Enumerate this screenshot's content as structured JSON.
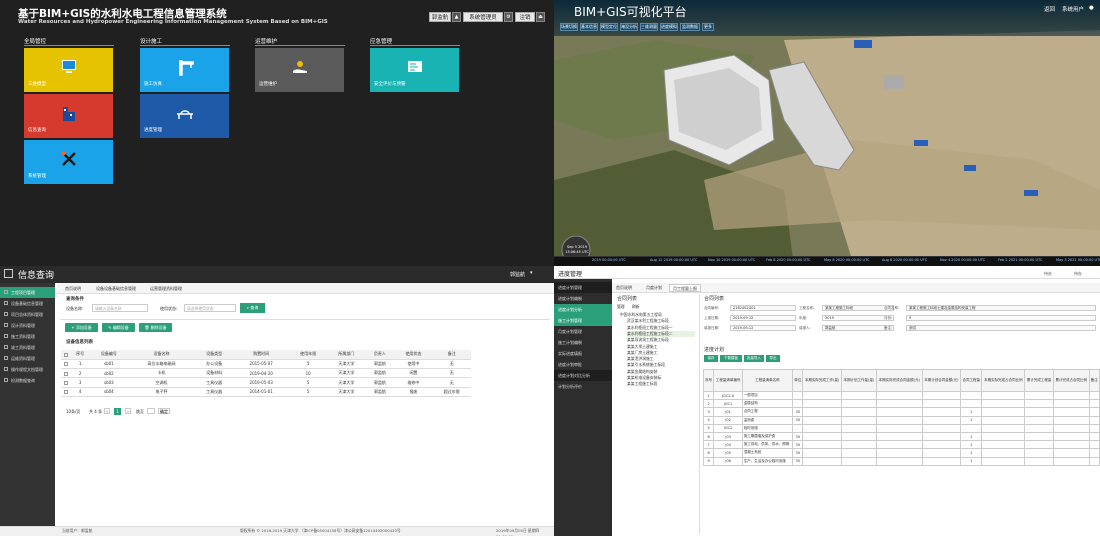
{
  "q1": {
    "title": "基于BIM+GIS的水利水电工程信息管理系统",
    "subtitle": "Water Resources and Hydropower Engineering Information Management System Based on BIM+GIS",
    "top_buttons": [
      "郭监航",
      "系统管理员",
      "注销"
    ],
    "categories": [
      "全局管控",
      "设计施工",
      "运营维护",
      "应急管理"
    ],
    "tiles": [
      {
        "label": "三维模型",
        "color": "#e6c300",
        "icon": "monitor-icon"
      },
      {
        "label": "施工仿真",
        "color": "#1aa3e8",
        "icon": "crane-icon"
      },
      {
        "label": "运营维护",
        "color": "#5a5a5a",
        "icon": "hand-coin-icon"
      },
      {
        "label": "安全评价与预警",
        "color": "#19b3b3",
        "icon": "blueprint-icon"
      },
      {
        "label": "信息查询",
        "color": "#d63a2f",
        "icon": "building-icon"
      },
      {
        "label": "进度管理",
        "color": "#1f5aa8",
        "icon": "bridge-icon"
      },
      {
        "label": "系统管理",
        "color": "#1aa3e8",
        "icon": "tools-icon"
      }
    ]
  },
  "q2": {
    "title": "BIM+GIS可视化平台",
    "right": [
      "返回",
      "系统用户"
    ],
    "tabs": [
      "场景切换",
      "基本信息",
      "模型定位",
      "淹没分析",
      "三维测量",
      "进度模拟",
      "监测数据",
      "更多"
    ],
    "timeline": [
      "2019 00:00:00 UTC",
      "Aug 12 2019 00:00:00 UTC",
      "Nov 10 2019 00:00:00 UTC",
      "Feb 8 2020 00:00:00 UTC",
      "May 8 2020 00:00:00 UTC",
      "Aug 6 2020 00:00:00 UTC",
      "Nov 4 2020 00:00:00 UTC",
      "Feb 2 2021 00:00:00 UTC",
      "May 3 2021 00:00:00 UTC"
    ],
    "clock": {
      "date": "Sep 5 2019",
      "time": "13:06:45 UTC"
    }
  },
  "q3": {
    "page_title": "信息查询",
    "user": "郭监航",
    "sidebar": [
      "工程项目管理",
      "设备基础信息管理",
      "项目总体资料管理",
      "设计资料管理",
      "施工资料管理",
      "竣工资料管理",
      "运维资料管理",
      "操作规程文档管理",
      "检测数据查询"
    ],
    "tabs": [
      "首页说明",
      "设备设备基础信息管理",
      "运营管理资料管理"
    ],
    "query_label": "查询条件",
    "field_name": "设备名称:",
    "field_name_ph": "请输入设备名称",
    "field_status": "使用状态:",
    "field_status_ph": "请选择使用状态",
    "search_btn": "查询",
    "buttons": [
      "添加设备",
      "编辑设备",
      "删除设备"
    ],
    "list_title": "设备信息列表",
    "headers": [
      "序号",
      "设备编号",
      "设备名称",
      "设备类型",
      "购置时间",
      "使用年限",
      "所属部门",
      "负责人",
      "使用状态",
      "备注"
    ],
    "rows": [
      [
        "1",
        "sb01",
        "高位水箱电磁阀",
        "办公设备",
        "2015-05-07",
        "5",
        "天津大学",
        "郭监航",
        "使用中",
        "无"
      ],
      [
        "2",
        "sb02",
        "卡机",
        "设备材料",
        "2019-04-20",
        "10",
        "天津大学",
        "郭监航",
        "闲置",
        "无"
      ],
      [
        "3",
        "sb03",
        "空调机",
        "工具仪器",
        "2019-05-03",
        "5",
        "天津大学",
        "郭监航",
        "维修中",
        "无"
      ],
      [
        "4",
        "sb04",
        "电子秤",
        "工具仪器",
        "2014-01-01",
        "5",
        "天津大学",
        "郭监航",
        "报废",
        "超过年限"
      ]
    ],
    "pager": "10条/页",
    "pager_total": "共 4 条",
    "pager_page": "1",
    "pager_goto": "跳至",
    "pager_ok": "确定",
    "footer_left": "当前用户：郭监航",
    "footer_mid": "版权所有 © 2016-2019  天津大学 （津ICP备05004158号）津公网安备12010402000410号",
    "footer_right": "2019年09月05日 星期四 11:16:00"
  },
  "q4": {
    "page_title": "进度管理",
    "right": [
      "待办",
      "待办"
    ],
    "side_items": [
      "进度计划管理",
      "进度计划编制",
      "进度计划分析",
      "施工计划管理",
      "月度计划管理",
      "施工计划编制",
      "实际进度填报",
      "进度计划审批",
      "进度计划对比分析",
      "计划分析评价"
    ],
    "tabs": [
      "首页说明",
      "月度计划",
      "月工程量上报"
    ],
    "tree_title": "合同列表",
    "tree_btns": [
      "管理",
      "刷新"
    ],
    "tree": [
      "中国水利水电第五工程局",
      "武汉某水利工程施工标段",
      "某水利枢纽工程施工标段一",
      "某水利枢纽工程施工标段二",
      "某某导流洞工程施工标段",
      "某某大坝土建施工",
      "某某厂房土建施工",
      "某某泄洪洞施工",
      "某某引水系统施工标段",
      "某某金属结构安装",
      "某某机电设备安装标",
      "某某工程施工标段"
    ],
    "form_title": "合同列表",
    "form": [
      [
        "合同编号:",
        "21624S2G01",
        "工程名称:",
        "某某工程施工标段",
        "合同名称:",
        "某某工程施工标段土建及金属结构安装工程"
      ],
      [
        "上报日期:",
        "2019-09-12",
        "年度:",
        "2019",
        "月份:",
        "9"
      ],
      [
        "填报日期:",
        "2019-09-12",
        "填报人:",
        "郭监航",
        "备注:",
        "测试"
      ]
    ],
    "plan_title": "进度计划",
    "plan_btns": [
      "保存",
      "下载模板",
      "批量导入",
      "导出"
    ],
    "plan_headers": [
      "序号",
      "工程量清单编号",
      "工程量清单名称",
      "单位",
      "本期实际完成工作(量)",
      "本期计划工作量(量)",
      "本期实际完成合同金额(元)",
      "本期计划合同金额(元)",
      "合同工程量",
      "本期实际完成占合同比例",
      "累计完成工程量",
      "累计完成占合同比例",
      "备注"
    ],
    "plan_rows": [
      [
        "1",
        "JGC2-0",
        "一般项目",
        "",
        "",
        "",
        "",
        "",
        "",
        "",
        "",
        "",
        ""
      ],
      [
        "2",
        "JGC1",
        "金属结构",
        "",
        "",
        "",
        "",
        "",
        "",
        "",
        "",
        "",
        ""
      ],
      [
        "3",
        "J01",
        "合同工程",
        "30",
        "",
        "",
        "",
        "",
        "1",
        "",
        "",
        "",
        ""
      ],
      [
        "4",
        "J02",
        "监测费",
        "30",
        "",
        "",
        "",
        "",
        "1",
        "",
        "",
        "",
        ""
      ],
      [
        "5",
        "JGC2",
        "临时设施",
        "",
        "",
        "",
        "",
        "",
        "",
        "",
        "",
        "",
        ""
      ],
      [
        "6",
        "J03",
        "施工期围堰及保护费",
        "30",
        "",
        "",
        "",
        "",
        "1",
        "",
        "",
        "",
        ""
      ],
      [
        "7",
        "J04",
        "施工供电、供风、供水、照明",
        "30",
        "",
        "",
        "",
        "",
        "1",
        "",
        "",
        "",
        ""
      ],
      [
        "8",
        "J05",
        "混凝土系统",
        "30",
        "",
        "",
        "",
        "",
        "1",
        "",
        "",
        "",
        ""
      ],
      [
        "9",
        "J06",
        "生产、生活及办公临时设施",
        "30",
        "",
        "",
        "",
        "",
        "1",
        "",
        "",
        "",
        ""
      ]
    ]
  }
}
